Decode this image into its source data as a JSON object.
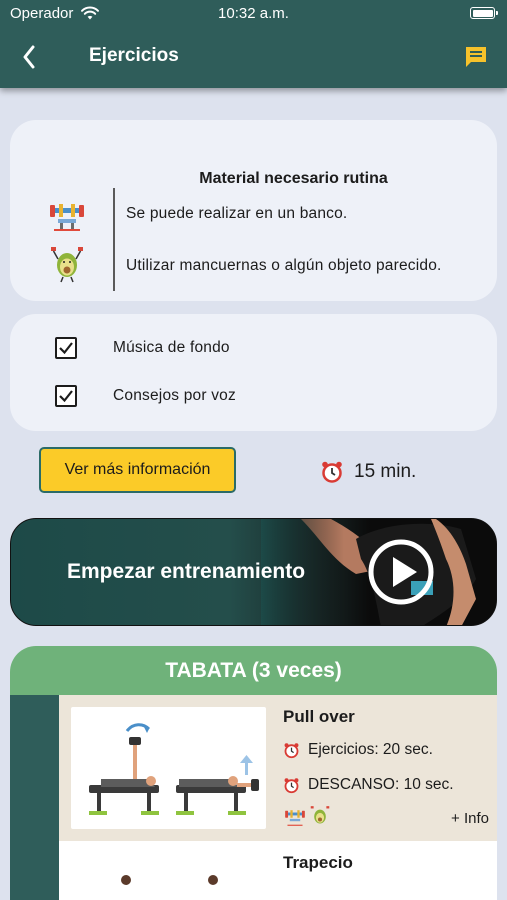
{
  "status_bar": {
    "carrier": "Operador",
    "time": "10:32 a.m."
  },
  "nav": {
    "title": "Ejercicios",
    "back_icon": "chevron-left-icon",
    "action_icon": "chat-icon"
  },
  "material": {
    "title": "Material necesario rutina",
    "items": [
      {
        "icon": "bench-icon",
        "text": "Se puede realizar en un banco."
      },
      {
        "icon": "avocado-dumbbell-icon",
        "text": "Utilizar mancuernas o algún objeto parecido."
      }
    ]
  },
  "options": [
    {
      "label": "Música de fondo",
      "checked": true
    },
    {
      "label": "Consejos por voz",
      "checked": true
    }
  ],
  "info_button": "Ver más información",
  "duration": "15 min.",
  "start_button": "Empezar entrenamiento",
  "tabata": {
    "title": "TABATA (3 veces)",
    "exercises": [
      {
        "name": "Pull over",
        "exercise_time": "Ejercicios: 20 sec.",
        "rest_time": "DESCANSO: 10 sec.",
        "more": "+ Info"
      },
      {
        "name": "Trapecio"
      }
    ]
  },
  "colors": {
    "header": "#2f5d5a",
    "accent_yellow": "#fbcb28",
    "tabata_green": "#6fb27a",
    "background": "#dde2ee",
    "card": "#eef1f8",
    "exercise_bg": "#ece5d9"
  }
}
